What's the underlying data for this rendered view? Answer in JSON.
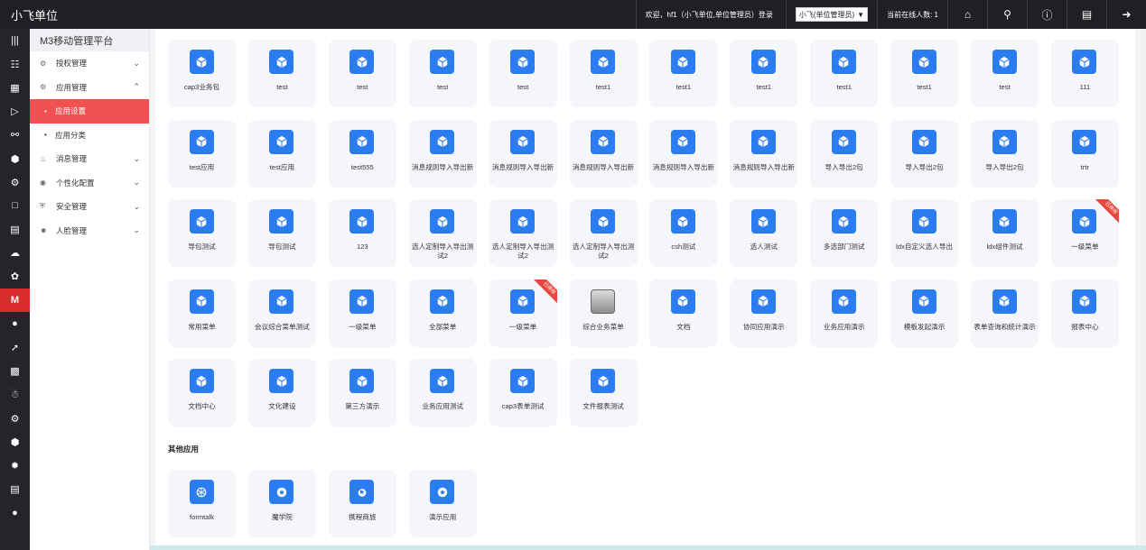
{
  "topbar": {
    "brand": "小飞单位",
    "welcome": "欢迎，hf1（小飞单位,单位管理员）登录",
    "unit_select": "小飞(单位管理员)",
    "online": "当前在线人数: 1"
  },
  "sidebar": {
    "title": "M3移动管理平台",
    "menu": [
      {
        "label": "授权管理",
        "icon": "gear-icon",
        "expanded": false
      },
      {
        "label": "应用管理",
        "icon": "gear-icon",
        "expanded": true
      },
      {
        "label": "应用设置",
        "sub": true,
        "active": true
      },
      {
        "label": "应用分类",
        "sub": true,
        "active": false
      },
      {
        "label": "消息管理",
        "icon": "bell-icon",
        "expanded": false
      },
      {
        "label": "个性化配置",
        "icon": "palette-icon",
        "expanded": false
      },
      {
        "label": "安全管理",
        "icon": "shield-icon",
        "expanded": false
      },
      {
        "label": "人脸管理",
        "icon": "face-icon",
        "expanded": false
      }
    ]
  },
  "apps": [
    {
      "name": "cap3业务包"
    },
    {
      "name": "test"
    },
    {
      "name": "test"
    },
    {
      "name": "test"
    },
    {
      "name": "test"
    },
    {
      "name": "test1"
    },
    {
      "name": "test1"
    },
    {
      "name": "test1"
    },
    {
      "name": "test1"
    },
    {
      "name": "test1"
    },
    {
      "name": "test"
    },
    {
      "name": "111"
    },
    {
      "name": "test应用"
    },
    {
      "name": "test应用"
    },
    {
      "name": "test555"
    },
    {
      "name": "消息规则导入导出新"
    },
    {
      "name": "消息规则导入导出新"
    },
    {
      "name": "消息规则导入导出新"
    },
    {
      "name": "消息规则导入导出新"
    },
    {
      "name": "消息规则导入导出新"
    },
    {
      "name": "导入导出2包"
    },
    {
      "name": "导入导出2包"
    },
    {
      "name": "导入导出2包"
    },
    {
      "name": "trtr"
    },
    {
      "name": "导包测试"
    },
    {
      "name": "导包测试"
    },
    {
      "name": "123"
    },
    {
      "name": "选人定制导入导出测试2"
    },
    {
      "name": "选人定制导入导出测试2"
    },
    {
      "name": "选人定制导入导出测试2"
    },
    {
      "name": "csh测试"
    },
    {
      "name": "选人测试"
    },
    {
      "name": "多选部门测试"
    },
    {
      "name": "ldx自定义选人导出"
    },
    {
      "name": "ldx组件测试"
    },
    {
      "name": "一级菜单",
      "ribbon": "已停用"
    },
    {
      "name": "常用菜单"
    },
    {
      "name": "会议综合菜单测试"
    },
    {
      "name": "一级菜单"
    },
    {
      "name": "全部菜单"
    },
    {
      "name": "一级菜单",
      "ribbon": "已停用"
    },
    {
      "name": "综合业务菜单",
      "photo": true
    },
    {
      "name": "文档"
    },
    {
      "name": "协同应用演示"
    },
    {
      "name": "业务应用演示"
    },
    {
      "name": "模板发起演示"
    },
    {
      "name": "表单查询和统计演示"
    },
    {
      "name": "报表中心"
    },
    {
      "name": "文档中心"
    },
    {
      "name": "文化建设"
    },
    {
      "name": "第三方演示"
    },
    {
      "name": "业务应用测试"
    },
    {
      "name": "cap3表单测试"
    },
    {
      "name": "文件报表测试"
    }
  ],
  "other_section_title": "其他应用",
  "other_apps": [
    {
      "name": "formtalk",
      "icon": "snowflake-icon"
    },
    {
      "name": "魔学院",
      "icon": "star-icon"
    },
    {
      "name": "携程商旅",
      "icon": "plane-icon"
    },
    {
      "name": "演示应用",
      "icon": "star-icon"
    }
  ],
  "ribbon_label": "已停用",
  "colors": {
    "accent_red": "#f25152",
    "app_blue": "#2b7cf0",
    "topbar": "#1f2024"
  }
}
